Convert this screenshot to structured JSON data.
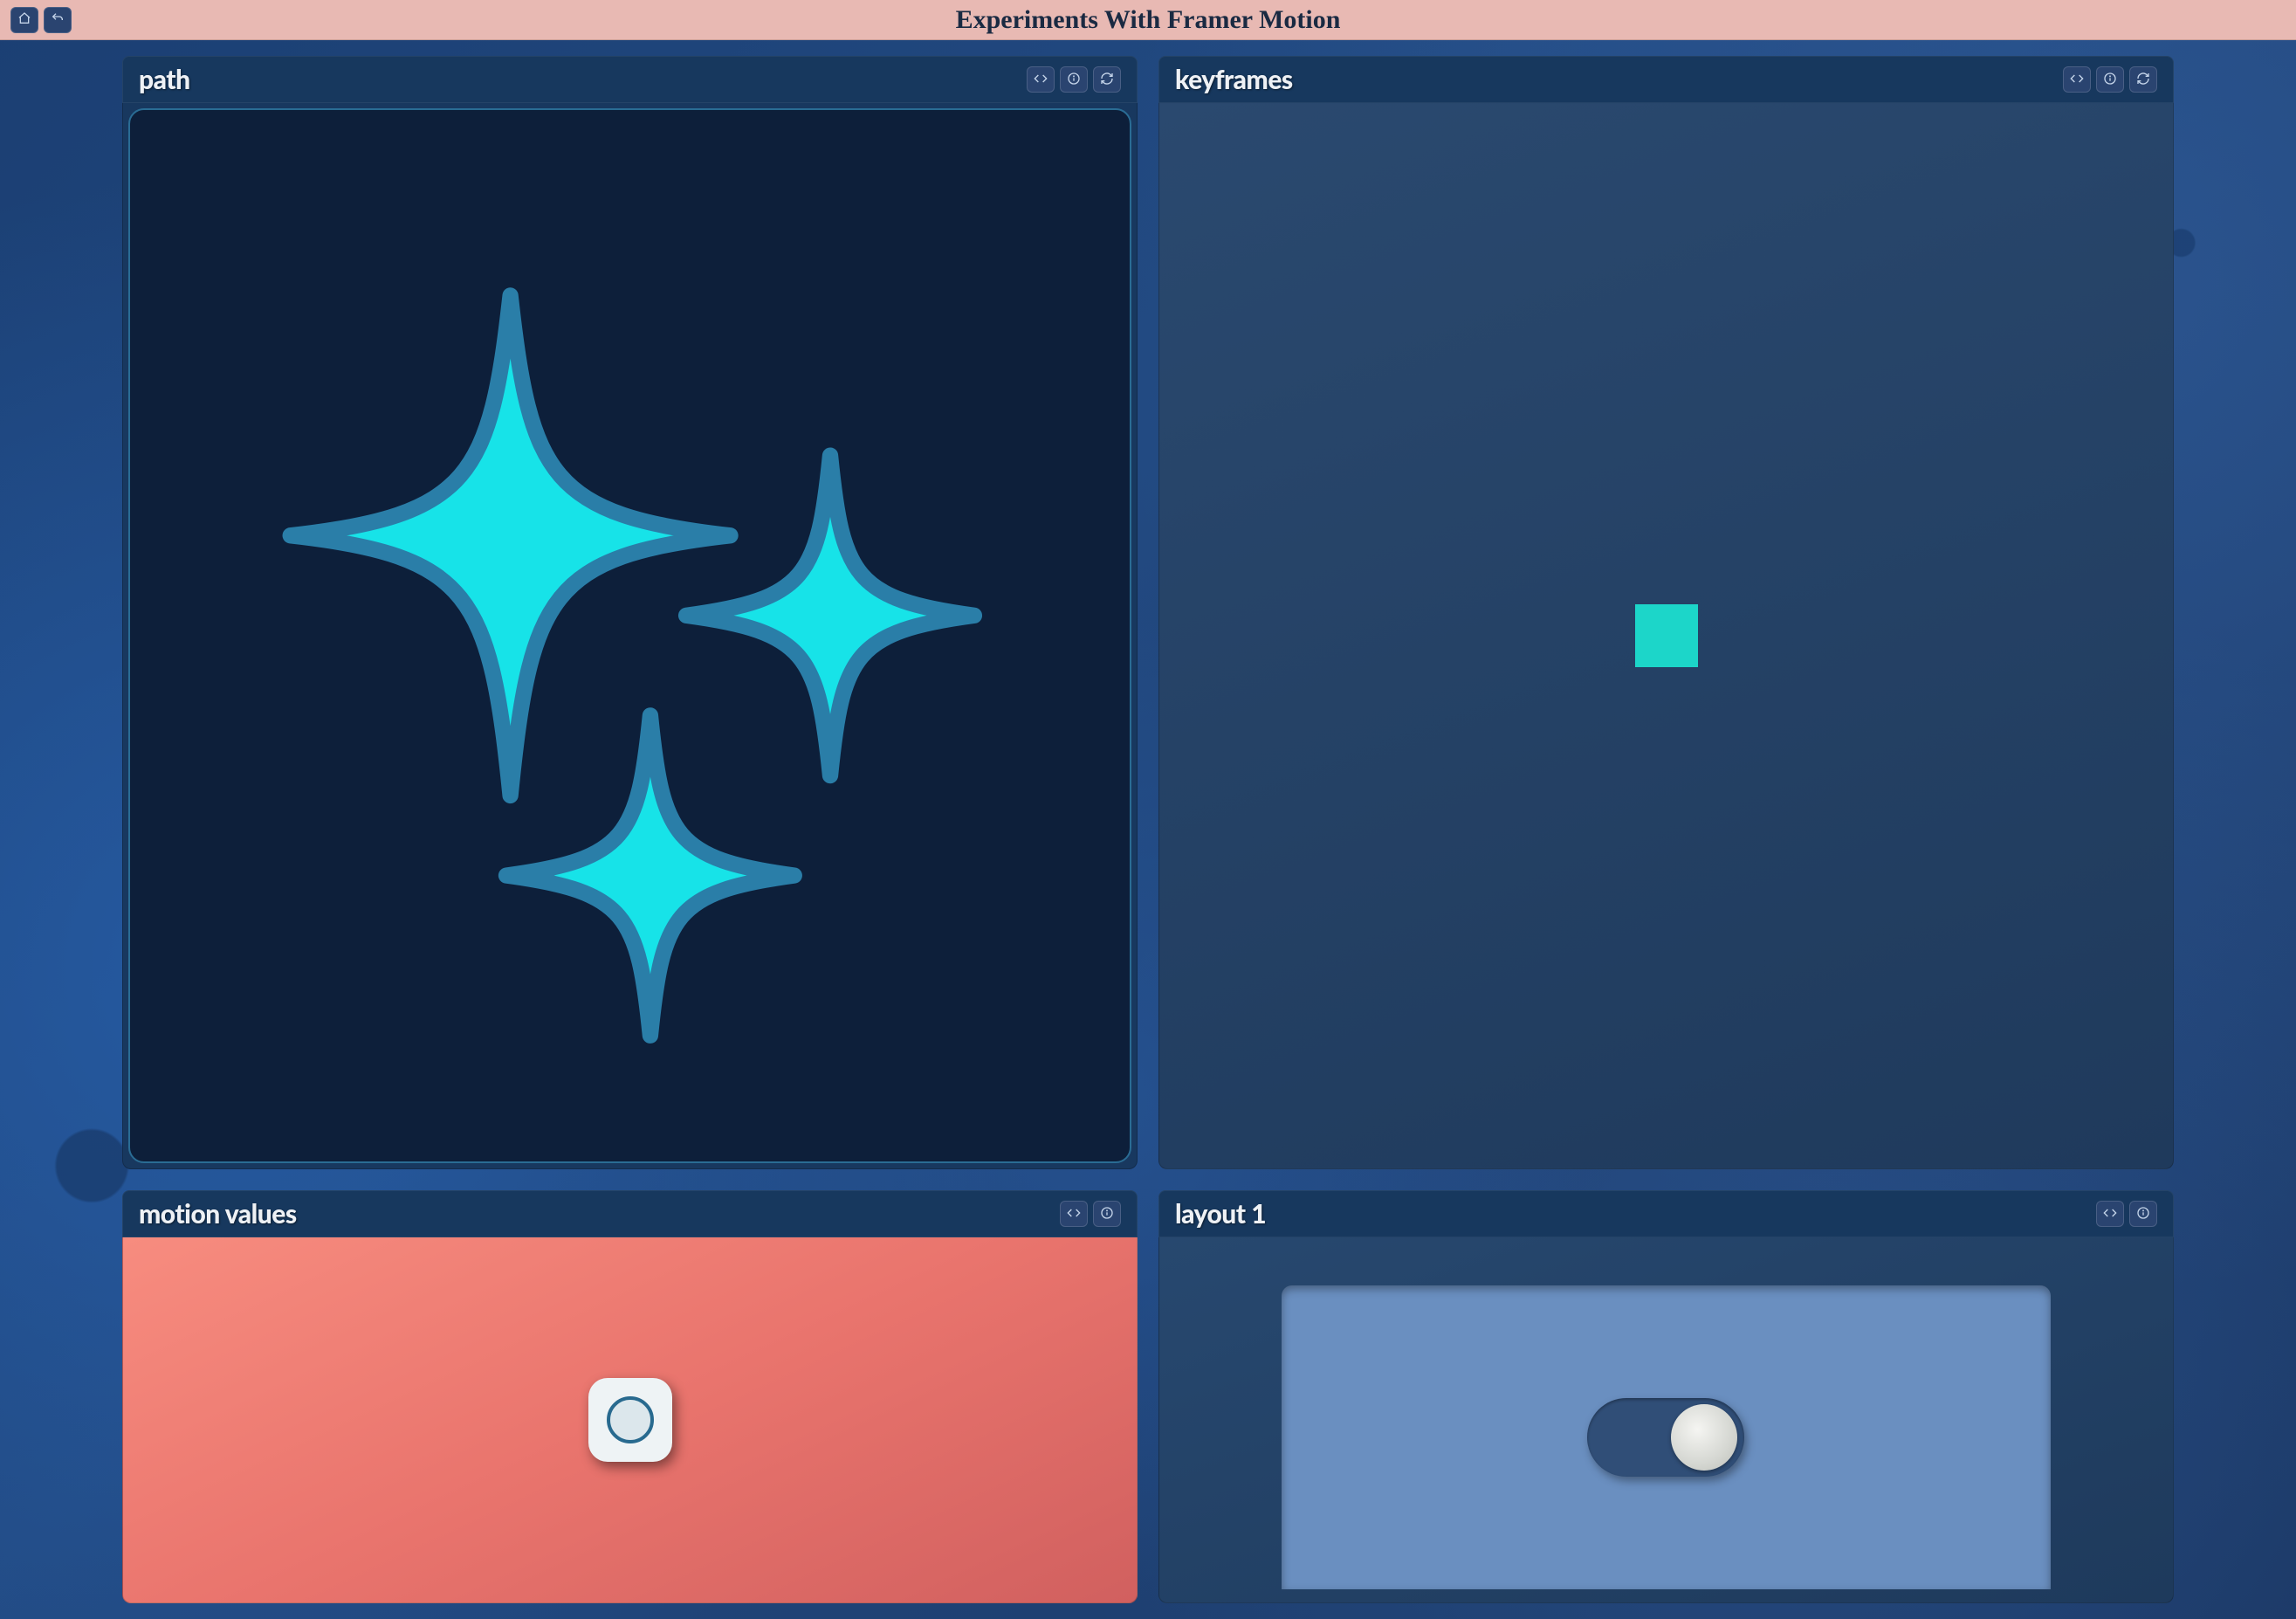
{
  "page": {
    "title": "Experiments With Framer Motion"
  },
  "header": {
    "home_icon": "home-icon",
    "back_icon": "back-arrow-icon"
  },
  "panels": [
    {
      "id": "path",
      "title": "path",
      "actions": [
        "code",
        "info",
        "refresh"
      ],
      "visual": "sparkles"
    },
    {
      "id": "keyframes",
      "title": "keyframes",
      "actions": [
        "code",
        "info",
        "refresh"
      ],
      "visual": "teal-square"
    },
    {
      "id": "motion-values",
      "title": "motion values",
      "actions": [
        "code",
        "info"
      ],
      "visual": "draggable-circle-chip"
    },
    {
      "id": "layout-1",
      "title": "layout 1",
      "actions": [
        "code",
        "info"
      ],
      "visual": "toggle-switch",
      "toggle_state": "on"
    }
  ],
  "colors": {
    "accent_cyan": "#17e3e8",
    "header_pink": "#e8b9b3",
    "panel_header": "#17385e",
    "toggle_bg": "#304e77"
  }
}
